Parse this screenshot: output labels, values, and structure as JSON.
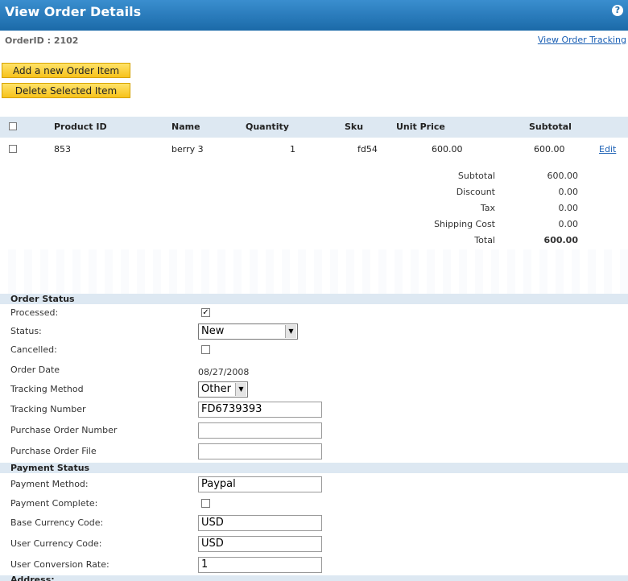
{
  "header": {
    "title": "View Order Details",
    "help_icon": "?"
  },
  "order": {
    "id_label": "OrderID : 2102",
    "tracking_link": "View Order Tracking"
  },
  "buttons": {
    "add_item": "Add a new Order Item",
    "delete_item": "Delete Selected Item"
  },
  "items_table": {
    "columns": [
      "Product ID",
      "Name",
      "Quantity",
      "Sku",
      "Unit Price",
      "Subtotal"
    ],
    "rows": [
      {
        "product_id": "853",
        "name": "berry 3",
        "quantity": "1",
        "sku": "fd54",
        "unit_price": "600.00",
        "subtotal": "600.00",
        "action": "Edit"
      }
    ]
  },
  "summary": [
    {
      "label": "Subtotal",
      "value": "600.00"
    },
    {
      "label": "Discount",
      "value": "0.00"
    },
    {
      "label": "Tax",
      "value": "0.00"
    },
    {
      "label": "Shipping Cost",
      "value": "0.00"
    },
    {
      "label": "Total",
      "value": "600.00"
    }
  ],
  "order_status": {
    "title": "Order Status",
    "processed_label": "Processed:",
    "processed": true,
    "status_label": "Status:",
    "status_value": "New",
    "cancelled_label": "Cancelled:",
    "cancelled": false,
    "order_date_label": "Order Date",
    "order_date": "08/27/2008",
    "tracking_method_label": "Tracking Method",
    "tracking_method": "Other",
    "tracking_number_label": "Tracking Number",
    "tracking_number": "FD6739393",
    "po_number_label": "Purchase Order Number",
    "po_number": "",
    "po_file_label": "Purchase Order File",
    "po_file": ""
  },
  "payment_status": {
    "title": "Payment Status",
    "method_label": "Payment Method:",
    "method": "Paypal",
    "complete_label": "Payment Complete:",
    "complete": false,
    "base_currency_label": "Base Currency Code:",
    "base_currency": "USD",
    "user_currency_label": "User Currency Code:",
    "user_currency": "USD",
    "conversion_label": "User Conversion Rate:",
    "conversion": "1"
  },
  "address": {
    "title": "Address:"
  }
}
